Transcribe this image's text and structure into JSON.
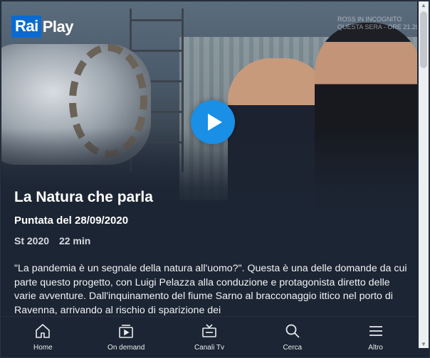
{
  "brand": {
    "logo_left": "Rai",
    "logo_right": "Play"
  },
  "hero": {
    "watermark_line1": "ROSS IN INCOGNITO",
    "watermark_line2": "QUESTA SERA - ORE 21.20"
  },
  "program": {
    "title": "La Natura che parla",
    "episode": "Puntata del 28/09/2020",
    "season": "St 2020",
    "duration": "22 min",
    "description": "\"La pandemia è un segnale della natura all'uomo?\". Questa è una delle domande da cui parte questo progetto, con Luigi Pelazza alla conduzione e protagonista diretto delle varie avventure. Dall'inquinamento del fiume Sarno al bracconaggio ittico nel porto di Ravenna, arrivando al rischio di sparizione dei"
  },
  "tabs": [
    {
      "label": "Home",
      "icon": "home-icon"
    },
    {
      "label": "On demand",
      "icon": "on-demand-icon"
    },
    {
      "label": "Canali Tv",
      "icon": "tv-icon"
    },
    {
      "label": "Cerca",
      "icon": "search-icon"
    },
    {
      "label": "Altro",
      "icon": "menu-icon"
    }
  ],
  "colors": {
    "background": "#1c2533",
    "accent": "#1a8fe6",
    "logo_blue": "#0a6ad1"
  }
}
